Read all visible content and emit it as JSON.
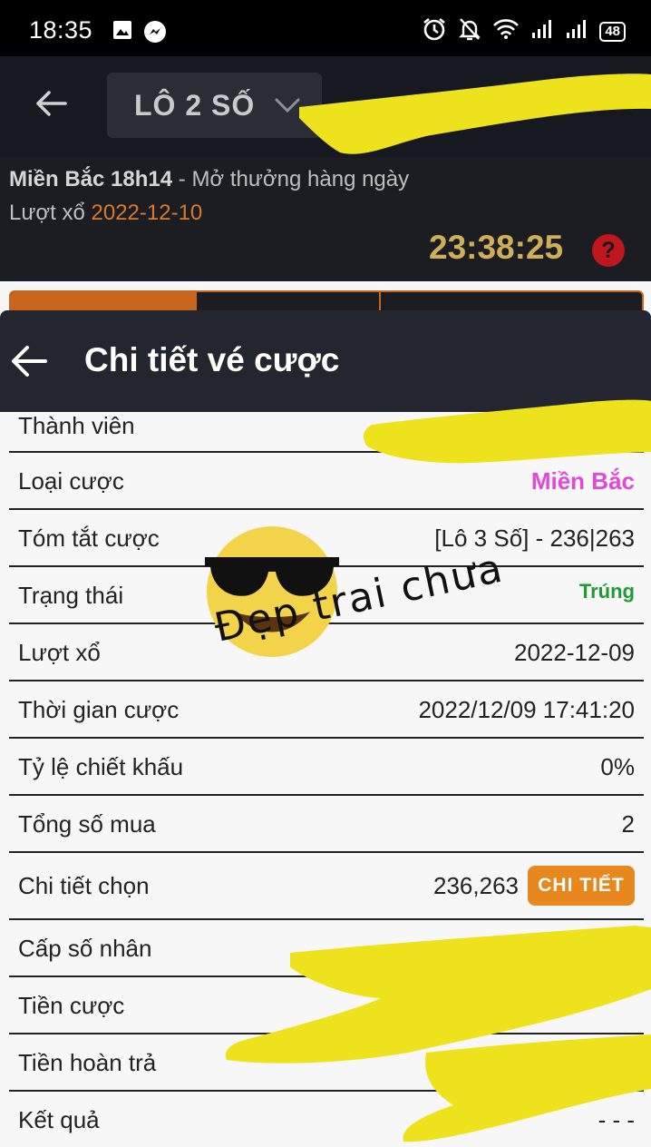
{
  "status_bar": {
    "time": "18:35",
    "battery": "48",
    "icons": [
      "image-icon",
      "messenger-icon",
      "alarm-icon",
      "mute-icon",
      "wifi-icon",
      "signal-icon",
      "signal-icon",
      "battery-icon"
    ]
  },
  "header": {
    "game_selector": "LÔ 2 SỐ"
  },
  "info": {
    "region": "Miền Bắc 18h14",
    "separator": "-",
    "schedule": "Mở thưởng hàng ngày",
    "draw_label": "Lượt xổ",
    "draw_date": "2022-12-10",
    "countdown": "23:38:25",
    "help": "?"
  },
  "sheet": {
    "title": "Chi tiết vé cược",
    "rows": [
      {
        "label": "Thành viên",
        "value": ""
      },
      {
        "label": "Loại cược",
        "value": "Miền Bắc"
      },
      {
        "label": "Tóm tắt cược",
        "value": "[Lô 3 Số] - 236|263"
      },
      {
        "label": "Trạng thái",
        "value": "Trúng"
      },
      {
        "label": "Lượt xổ",
        "value": "2022-12-09"
      },
      {
        "label": "Thời gian cược",
        "value": "2022/12/09 17:41:20"
      },
      {
        "label": "Tỷ lệ chiết khấu",
        "value": "0%"
      },
      {
        "label": "Tổng số mua",
        "value": "2"
      },
      {
        "label": "Chi tiết chọn",
        "value": "236,263",
        "button": "CHI TIẾT"
      },
      {
        "label": "Cấp số nhân",
        "value": ""
      },
      {
        "label": "Tiền cược",
        "value": ""
      },
      {
        "label": "Tiền hoàn trả",
        "value": ""
      },
      {
        "label": "Kết quả",
        "value": "- - -"
      }
    ]
  },
  "annotation": {
    "handwriting": "Đẹp trai chưa"
  },
  "colors": {
    "header_bg": "#16191f",
    "accent_orange": "#e8871d",
    "countdown_gold": "#cfae58",
    "pink": "#e14ad8",
    "green": "#1f9a37",
    "highlighter": "#eee21c"
  }
}
